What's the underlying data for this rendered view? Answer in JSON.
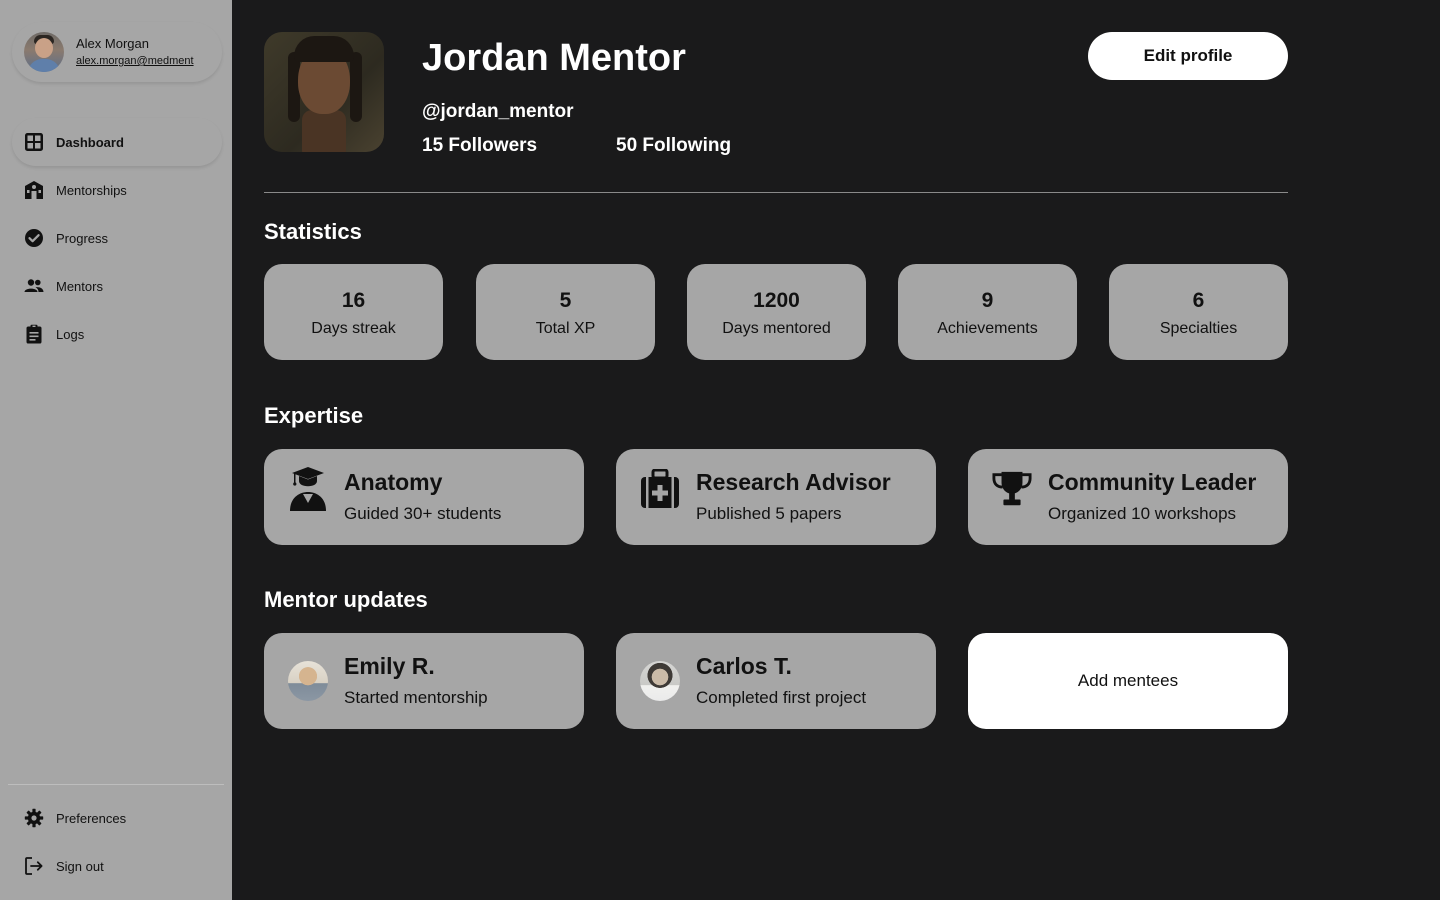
{
  "user": {
    "name": "Alex Morgan",
    "email": "alex.morgan@medment"
  },
  "nav": {
    "items": [
      {
        "label": "Dashboard",
        "icon": "dashboard-icon",
        "active": true
      },
      {
        "label": "Mentorships",
        "icon": "school-icon",
        "active": false
      },
      {
        "label": "Progress",
        "icon": "check-circle-icon",
        "active": false
      },
      {
        "label": "Mentors",
        "icon": "people-icon",
        "active": false
      },
      {
        "label": "Logs",
        "icon": "clipboard-icon",
        "active": false
      }
    ],
    "bottom": [
      {
        "label": "Preferences",
        "icon": "gear-icon"
      },
      {
        "label": "Sign out",
        "icon": "sign-out-icon"
      }
    ]
  },
  "profile": {
    "name": "Jordan Mentor",
    "handle": "@jordan_mentor",
    "followers": "15 Followers",
    "following": "50 Following",
    "edit_label": "Edit profile"
  },
  "sections": {
    "statistics": "Statistics",
    "expertise": "Expertise",
    "updates": "Mentor updates"
  },
  "stats": [
    {
      "value": "16",
      "label": "Days streak"
    },
    {
      "value": "5",
      "label": "Total XP"
    },
    {
      "value": "1200",
      "label": "Days mentored"
    },
    {
      "value": "9",
      "label": "Achievements"
    },
    {
      "value": "6",
      "label": "Specialties"
    }
  ],
  "expertise": [
    {
      "title": "Anatomy",
      "subtitle": "Guided 30+ students",
      "icon": "graduate-icon"
    },
    {
      "title": "Research Advisor",
      "subtitle": "Published 5 papers",
      "icon": "medical-kit-icon"
    },
    {
      "title": "Community Leader",
      "subtitle": "Organized 10 workshops",
      "icon": "trophy-icon"
    }
  ],
  "updates": [
    {
      "name": "Emily R.",
      "text": "Started mentorship"
    },
    {
      "name": "Carlos T.",
      "text": "Completed first project"
    }
  ],
  "add_mentees_label": "Add mentees",
  "colors": {
    "background": "#1a1a1b",
    "sidebar": "#a6a6a6",
    "card": "#a6a6a6",
    "button": "#ffffff"
  }
}
